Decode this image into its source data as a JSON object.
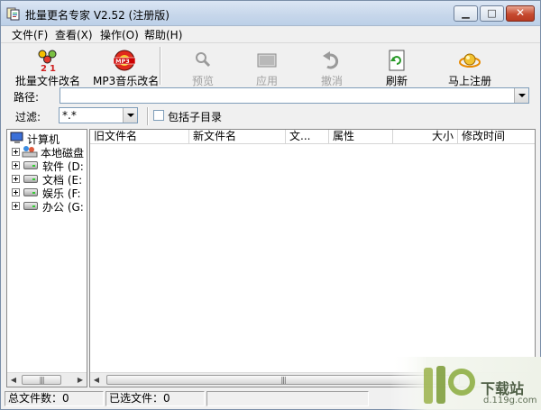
{
  "window": {
    "title": "批量更名专家 V2.52 (注册版)"
  },
  "menu": [
    {
      "label": "文件(F)"
    },
    {
      "label": "查看(X)"
    },
    {
      "label": "操作(O)"
    },
    {
      "label": "帮助(H)"
    }
  ],
  "toolbar": {
    "batch_rename": "批量文件改名",
    "mp3_rename": "MP3音乐改名",
    "preview": "预览",
    "apply": "应用",
    "undo": "撤消",
    "refresh": "刷新",
    "register": "马上注册"
  },
  "path": {
    "label": "路径:",
    "value": ""
  },
  "filter": {
    "label": "过滤:",
    "value": "*.*",
    "include_subdirs_label": "包括子目录",
    "include_subdirs_checked": false
  },
  "tree": {
    "root": "计算机",
    "items": [
      {
        "label": "本地磁盘"
      },
      {
        "label": "软件  (D:"
      },
      {
        "label": "文档  (E:"
      },
      {
        "label": "娱乐  (F:"
      },
      {
        "label": "办公  (G:"
      }
    ]
  },
  "list": {
    "columns": [
      {
        "label": "旧文件名"
      },
      {
        "label": "新文件名"
      },
      {
        "label": "文..."
      },
      {
        "label": "属性"
      },
      {
        "label": "大小"
      },
      {
        "label": "修改时间"
      }
    ]
  },
  "status": {
    "total_files": "总文件数：0",
    "selected_files": "已选文件：0"
  },
  "watermark": {
    "site_name": "下载站",
    "site_url": "d.119g.com"
  }
}
